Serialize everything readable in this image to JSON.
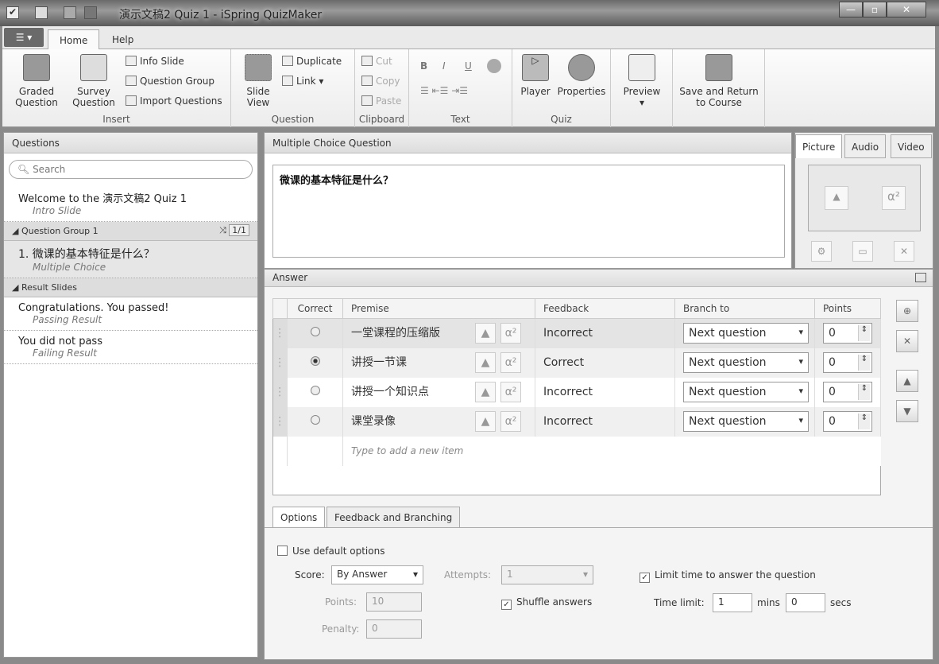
{
  "window": {
    "title": "演示文稿2 Quiz 1 - iSpring QuizMaker",
    "minimize": "—",
    "maximize": "▫",
    "close": "✕"
  },
  "tabs": [
    {
      "label": "Home"
    },
    {
      "label": "Help"
    }
  ],
  "ribbon": {
    "insert": {
      "label": "Insert",
      "graded": "Graded Question",
      "survey": "Survey Question",
      "info": "Info Slide",
      "group": "Question Group",
      "import": "Import Questions"
    },
    "question": {
      "label": "Question",
      "slide_view": "Slide View",
      "duplicate": "Duplicate",
      "link": "Link ▾"
    },
    "clipboard": {
      "label": "Clipboard",
      "cut": "Cut",
      "copy": "Copy",
      "paste": "Paste"
    },
    "text": {
      "label": "Text",
      "bold": "B",
      "italic": "I",
      "underline": "U"
    },
    "quiz": {
      "label": "Quiz",
      "player": "Player",
      "properties": "Properties"
    },
    "preview": "Preview",
    "save_return": "Save and Return to Course"
  },
  "left": {
    "title": "Questions",
    "search_placeholder": "Search",
    "intro": {
      "title": "Welcome to the 演示文稿2 Quiz 1",
      "sub": "Intro Slide"
    },
    "group": {
      "title": "Question Group 1",
      "count": "1/1"
    },
    "question": {
      "title": "1. 微课的基本特征是什么？",
      "sub": "Multiple Choice"
    },
    "results_header": "Result Slides",
    "results": [
      {
        "title": "Congratulations. You passed!",
        "sub": "Passing Result"
      },
      {
        "title": "You did not pass",
        "sub": "Failing Result"
      }
    ]
  },
  "main": {
    "title": "Multiple Choice Question",
    "question_text": "微课的基本特征是什么？"
  },
  "media": {
    "tabs": [
      "Picture",
      "Audio",
      "Video"
    ],
    "formula": "α²"
  },
  "answer": {
    "title": "Answer",
    "columns": [
      "Correct",
      "Premise",
      "Feedback",
      "Branch to",
      "Points"
    ],
    "rows": [
      {
        "premise": "一堂课程的压缩版",
        "feedback": "Incorrect",
        "branch": "Next question",
        "points": "0",
        "correct": false
      },
      {
        "premise": "讲授一节课",
        "feedback": "Correct",
        "branch": "Next question",
        "points": "0",
        "correct": true
      },
      {
        "premise": "讲授一个知识点",
        "feedback": "Incorrect",
        "branch": "Next question",
        "points": "0",
        "correct": false
      },
      {
        "premise": "课堂录像",
        "feedback": "Incorrect",
        "branch": "Next question",
        "points": "0",
        "correct": false
      }
    ],
    "new_item_placeholder": "Type to add a new item"
  },
  "options": {
    "tabs": [
      "Options",
      "Feedback and Branching"
    ],
    "use_default": "Use default options",
    "score_label": "Score:",
    "score_value": "By Answer",
    "attempts_label": "Attempts:",
    "attempts_value": "1",
    "points_label": "Points:",
    "points_value": "10",
    "penalty_label": "Penalty:",
    "penalty_value": "0",
    "shuffle": "Shuffle answers",
    "shuffle_checked": true,
    "limit_time": "Limit time to answer the question",
    "limit_checked": true,
    "time_limit_label": "Time limit:",
    "mins_value": "1",
    "mins_label": "mins",
    "secs_value": "0",
    "secs_label": "secs"
  }
}
